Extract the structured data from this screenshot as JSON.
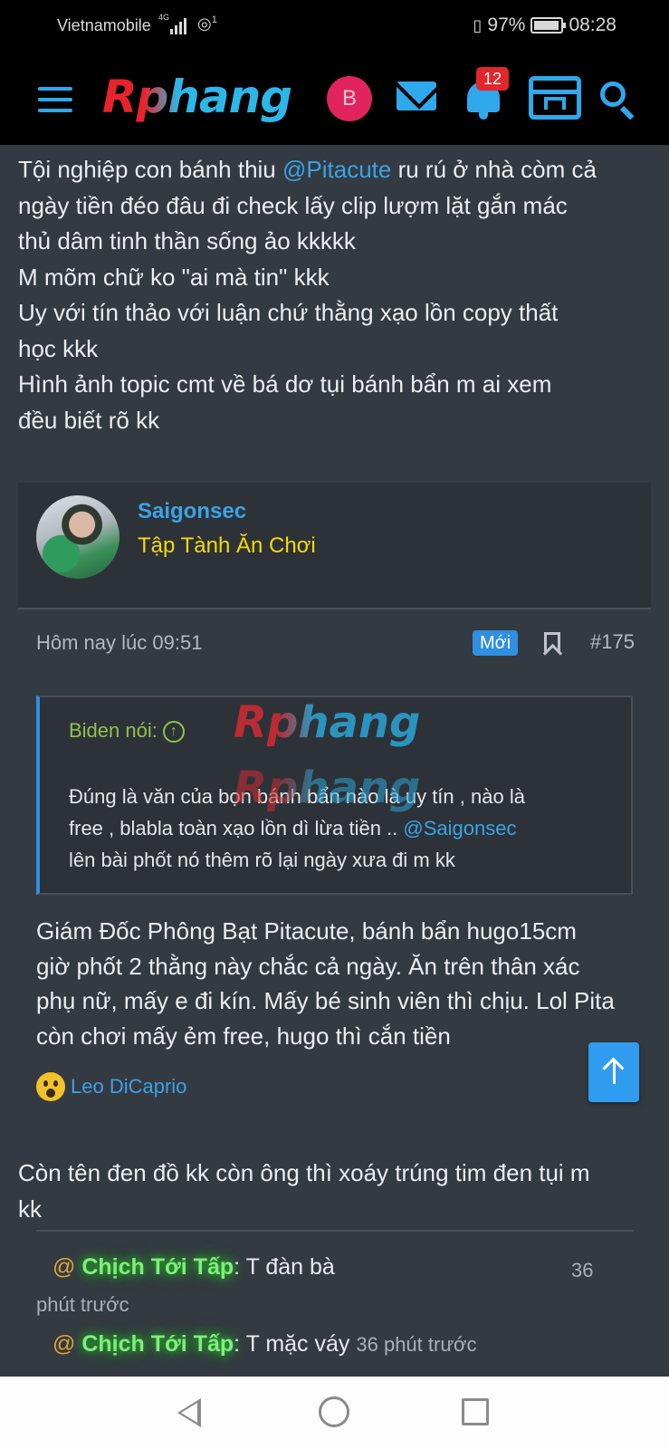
{
  "status_bar": {
    "carrier": "Vietnamobile",
    "network": "4G",
    "wifi_count": "1",
    "battery": "97%",
    "time": "08:28"
  },
  "topnav": {
    "logo": "Rphang",
    "avatar_letter": "B",
    "notification_count": "12",
    "accent_color": "#2fa8ec"
  },
  "post": {
    "lines": [
      [
        "Tội nghiệp con bánh thiu ",
        "@Pitacute",
        " ru rú ở nhà còm cả"
      ],
      "ngày tiền đéo đâu đi check lấy clip lượm lặt gắn mác",
      "thủ dâm tinh thần sống ảo kkkkk",
      "M mõm chữ ko \"ai mà tin\" kkk",
      "Uy với tín thảo với luận chứ thằng xạo lồn copy thất",
      "học kkk",
      "Hình ảnh topic cmt về bá dơ tụi bánh bẩn m ai xem",
      "đều biết rõ kk"
    ]
  },
  "author": {
    "name": "Saigonsec",
    "title": "Tập Tành Ăn Chơi"
  },
  "meta": {
    "time": "Hôm nay lúc 09:51",
    "new_label": "Mới",
    "post_number": "#175"
  },
  "quote": {
    "header": "Biden nói:",
    "line1": "Đúng là văn của bọn bánh bẩn nào là uy tín , nào là",
    "line2_a": "free , blabla toàn xạo lồn dì lừa tiền .. ",
    "line2_mention": "@Saigonsec",
    "line3": "lên bài phốt nó thêm rõ lại ngày xưa đi m kk"
  },
  "watermark": "Rphang",
  "reply": {
    "lines": [
      "Giám Đốc Phông Bạt Pitacute, bánh bẩn hugo15cm",
      "giờ phốt 2 thằng này chắc cả ngày. Ăn trên thân xác",
      "phụ nữ, mấy e đi kín. Mấy bé sinh viên thì chịu. Lol Pita",
      "còn chơi mấy ẻm free, hugo thì cắn tiền"
    ]
  },
  "reaction": {
    "name": "Leo DiCaprio"
  },
  "comment": {
    "line1": "Còn tên đen đồ kk còn ông thì xoáy trúng tim đen tụi m",
    "line2": "kk"
  },
  "chat": [
    {
      "at": "@",
      "user": "Chịch Tới Tấp",
      "text": ": T đàn bà",
      "time_a": "36",
      "time_b": "phút trước"
    },
    {
      "at": "@",
      "user": "Chịch Tới Tấp",
      "text": ": T mặc váy",
      "time": "36 phút trước"
    }
  ]
}
